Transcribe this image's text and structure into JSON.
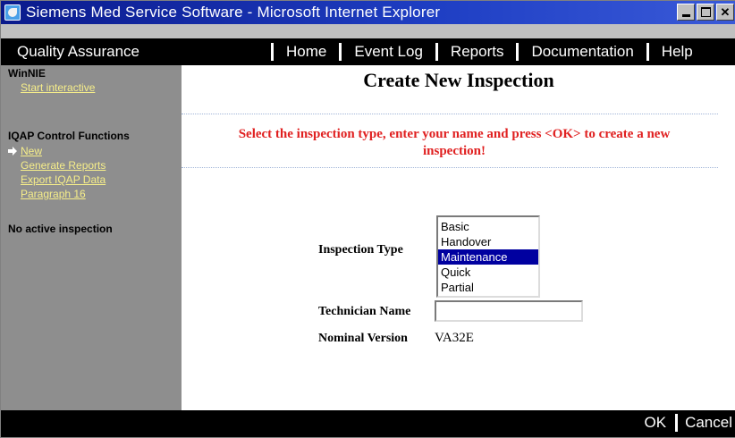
{
  "window": {
    "title": "Siemens Med Service Software - Microsoft Internet Explorer",
    "icon": "ie-icon",
    "controls": [
      "minimize",
      "maximize",
      "close"
    ]
  },
  "navbar": {
    "section_title": "Quality Assurance",
    "links": [
      "Home",
      "Event Log",
      "Reports",
      "Documentation",
      "Help"
    ]
  },
  "sidebar": {
    "group1_heading": "WinNIE",
    "group1_link": "Start interactive",
    "group2_heading": "IQAP Control Functions",
    "group2_links": [
      "New",
      "Generate Reports",
      "Export IQAP Data",
      "Paragraph 16"
    ],
    "status": "No active inspection"
  },
  "main": {
    "title": "Create New Inspection",
    "instruction_line1": "Select the inspection type, enter your name and press <OK> to create a new",
    "instruction_line2": "inspection!",
    "inspection_type_label": "Inspection Type",
    "inspection_types": [
      "Basic",
      "Handover",
      "Maintenance",
      "Quick",
      "Partial"
    ],
    "selected_inspection_type": "Maintenance",
    "technician_label": "Technician Name",
    "technician_value": "",
    "version_label": "Nominal Version",
    "version_value": "VA32E"
  },
  "bottombar": {
    "ok_label": "OK",
    "cancel_label": "Cancel"
  },
  "colors": {
    "title_bar": "#1f3fc4",
    "nav_background": "#000000",
    "sidebar_background": "#8e8e8e",
    "sidebar_link": "#f6ee8a",
    "instruction_text": "#e02020",
    "selection": "#0000a0"
  }
}
